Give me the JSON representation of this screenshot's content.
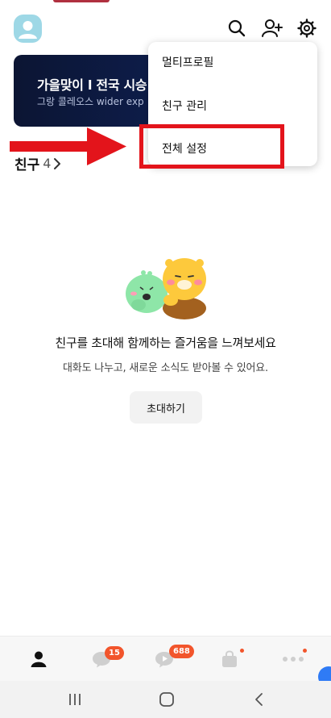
{
  "header": {
    "icons": [
      "profile-avatar",
      "search-icon",
      "add-friend-icon",
      "gear-icon"
    ]
  },
  "banner": {
    "title": "가을맞이 l 전국 시승",
    "subtitle": "그랑 콜레오스 wider exp"
  },
  "menu": {
    "items": [
      {
        "label": "멀티프로필"
      },
      {
        "label": "친구 관리"
      },
      {
        "label": "전체 설정"
      }
    ],
    "highlighted_item": "전체 설정"
  },
  "friends": {
    "title": "친구",
    "count": "4"
  },
  "empty_state": {
    "title": "친구를 초대해 함께하는 즐거움을 느껴보세요",
    "subtitle": "대화도 나누고, 새로운 소식도 받아볼 수 있어요.",
    "invite_label": "초대하기"
  },
  "tabbar": {
    "tabs": [
      {
        "icon": "person-icon"
      },
      {
        "icon": "chat-bubble-icon",
        "badge": "15"
      },
      {
        "icon": "openchat-icon",
        "badge": "688"
      },
      {
        "icon": "shopping-bag-icon",
        "dot": true
      },
      {
        "icon": "more-icon",
        "dot": true
      }
    ]
  },
  "colors": {
    "accent_red": "#e3141b",
    "badge": "#f2552c",
    "banner_bg": "#0d1c48"
  }
}
